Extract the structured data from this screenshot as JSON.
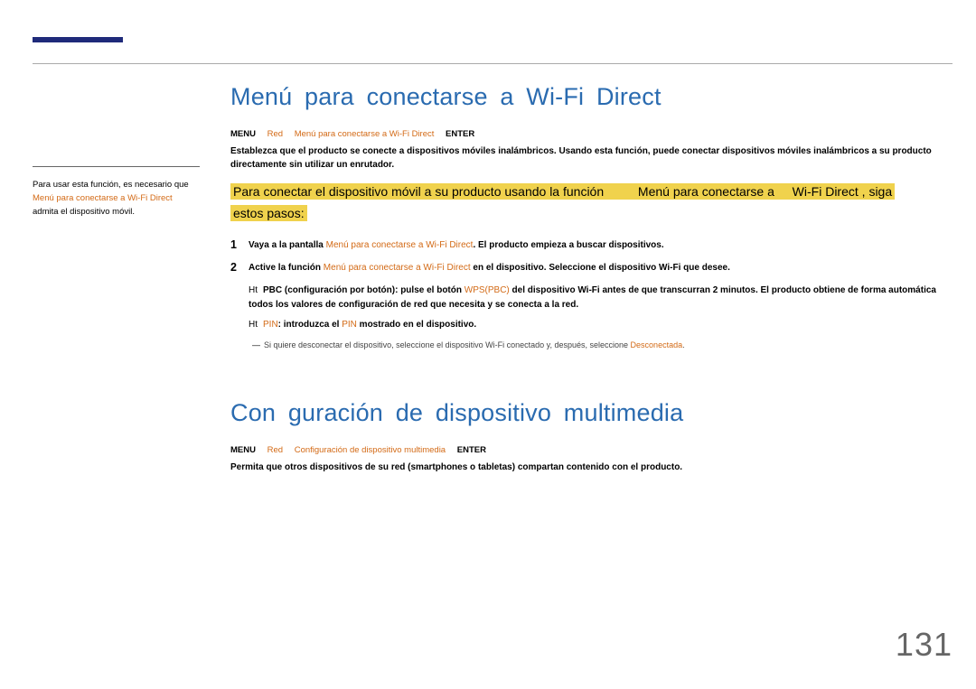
{
  "page_number": "131",
  "side_note": {
    "line1": "Para usar esta función, es necesario que",
    "line2_orange": "Menú para conectarse a Wi-Fi Direct",
    "line3": "admita el dispositivo móvil."
  },
  "section1": {
    "title": "Menú  para  conectarse   a Wi-Fi Direct",
    "nav_menu": "MENU",
    "nav_red": "Red",
    "nav_orange": "Menú para conectarse a Wi-Fi Direct",
    "nav_enter": "ENTER",
    "intro": "Establezca que el producto se conecte a dispositivos móviles inalámbricos. Usando esta función, puede conectar dispositivos móviles inalámbricos a su producto directamente sin utilizar un enrutador.",
    "highlight_a": "Para conectar el dispositivo móvil a su producto usando la función",
    "highlight_b": "Menú para conectarse a",
    "highlight_c": "Wi-Fi Direct , siga",
    "highlight_line2": "estos pasos:",
    "step1_pre": "Vaya a la pantalla ",
    "step1_orange": "Menú para conectarse a Wi-Fi Direct",
    "step1_post": ". El producto empieza a buscar dispositivos.",
    "step2_pre": "Active la función ",
    "step2_orange": "Menú para conectarse a Wi-Fi Direct",
    "step2_post": " en el dispositivo. Seleccione el dispositivo Wi-Fi que desee.",
    "sub_pbc_lead": "Ht",
    "sub_pbc_pre": "PBC (configuración por botón): pulse el botón ",
    "sub_pbc_orange": "WPS(PBC)",
    "sub_pbc_post": " del dispositivo Wi-Fi antes de que transcurran 2 minutos. El producto obtiene de forma automática todos los valores de configuración de red que necesita y se conecta a la red.",
    "sub_pin_lead": "Ht",
    "sub_pin_orange1": "PIN",
    "sub_pin_mid": ": introduzca el ",
    "sub_pin_orange2": "PIN",
    "sub_pin_post": " mostrado en el dispositivo.",
    "note_mark": "―",
    "note_pre": "Si quiere desconectar el dispositivo, seleccione el dispositivo Wi-Fi conectado y, después, seleccione ",
    "note_orange": "Desconectada",
    "note_post": "."
  },
  "section2": {
    "title": "Con guración    de dispositivo   multimedia",
    "nav_menu": "MENU",
    "nav_red": "Red",
    "nav_orange": "Configuración de dispositivo multimedia",
    "nav_enter": "ENTER",
    "body": "Permita que otros dispositivos de su red (smartphones o tabletas) compartan contenido con el producto."
  }
}
